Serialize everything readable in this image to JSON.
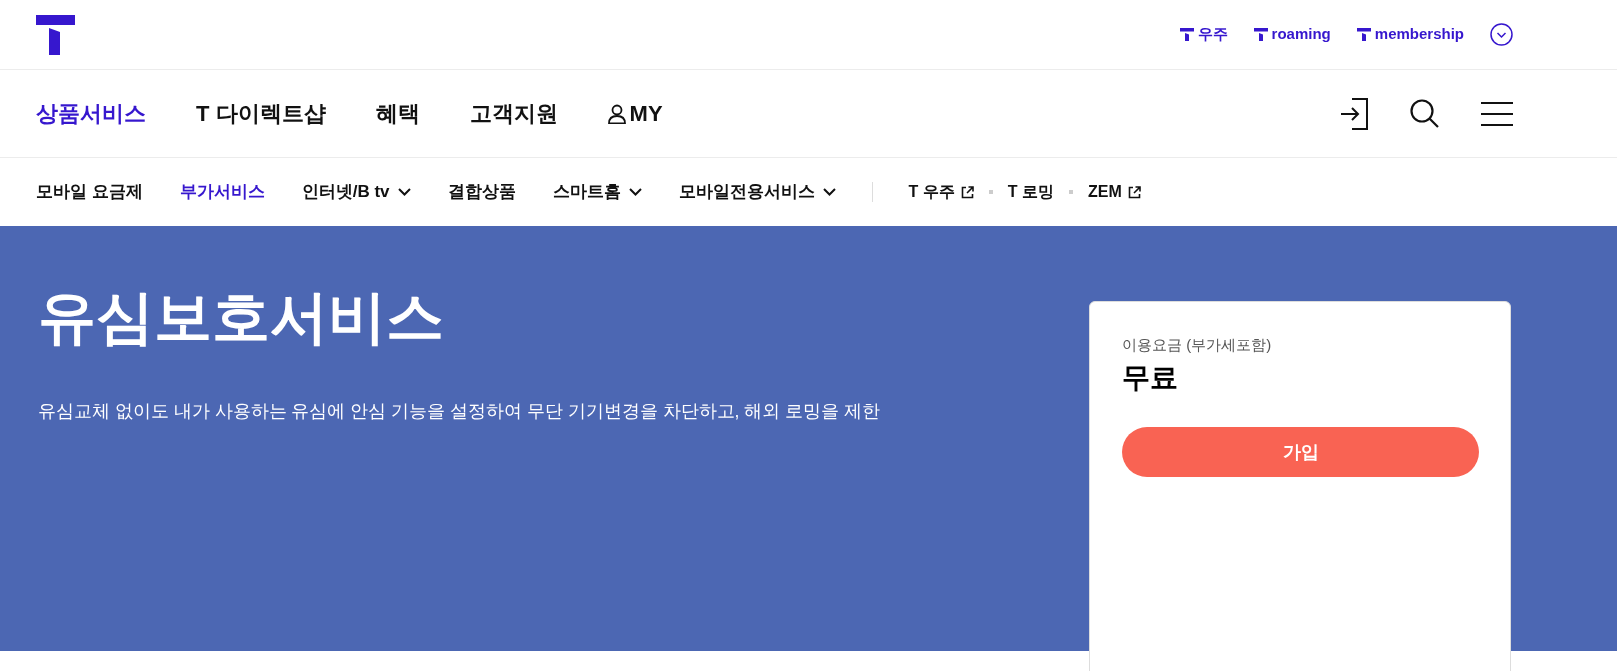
{
  "top_bar": {
    "links": [
      {
        "label": "우주"
      },
      {
        "label": "roaming"
      },
      {
        "label": "membership"
      }
    ]
  },
  "main_nav": {
    "items": [
      {
        "label": "상품서비스",
        "selected": true,
        "kind": "text"
      },
      {
        "label": "T 다이렉트샵",
        "selected": false,
        "kind": "text"
      },
      {
        "label": "혜택",
        "selected": false,
        "kind": "text"
      },
      {
        "label": "고객지원",
        "selected": false,
        "kind": "text"
      },
      {
        "label": "MY",
        "selected": false,
        "kind": "account"
      }
    ]
  },
  "sub_nav": {
    "items": [
      {
        "label": "모바일 요금제",
        "selected": false,
        "kind": "link"
      },
      {
        "label": "부가서비스",
        "selected": true,
        "kind": "link"
      },
      {
        "label": "인터넷/B tv",
        "selected": false,
        "kind": "dropdown"
      },
      {
        "label": "결합상품",
        "selected": false,
        "kind": "link"
      },
      {
        "label": "스마트홈",
        "selected": false,
        "kind": "dropdown"
      },
      {
        "label": "모바일전용서비스",
        "selected": false,
        "kind": "dropdown"
      }
    ],
    "quick_links": [
      {
        "label": "T 우주",
        "kind": "external"
      },
      {
        "label": "T 로밍",
        "kind": "link"
      },
      {
        "label": "ZEM",
        "kind": "external"
      }
    ]
  },
  "hero": {
    "title": "유심보호서비스",
    "description": "유심교체 없이도 내가 사용하는 유심에 안심 기능을 설정하여 무단 기기변경을 차단하고, 해외 로밍을 제한"
  },
  "price_card": {
    "label": "이용요금 (부가세포함)",
    "price": "무료",
    "button": "가입"
  }
}
